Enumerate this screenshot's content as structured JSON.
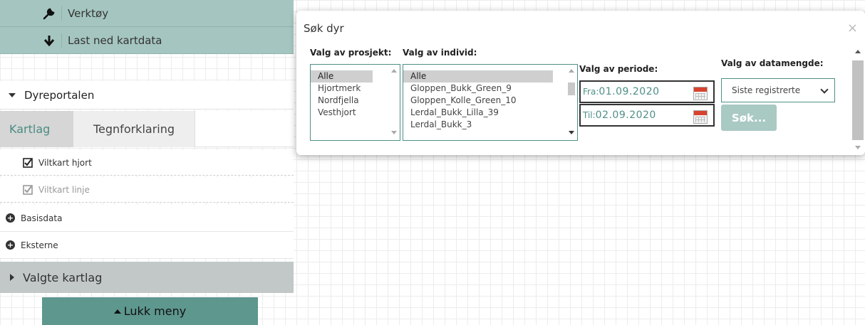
{
  "menu": {
    "tools_label": "Verktøy",
    "download_label": "Last ned kartdata",
    "portal_section": "Dyreportalen",
    "tabs": [
      {
        "label": "Kartlag"
      },
      {
        "label": "Tegnforklaring"
      }
    ],
    "layers": [
      {
        "label": "Viltkart hjort",
        "checked": true
      },
      {
        "label": "Viltkart linje",
        "checked": true
      }
    ],
    "groups": [
      {
        "label": "Basisdata"
      },
      {
        "label": "Eksterne"
      }
    ],
    "selected_layers": "Valgte kartlag",
    "close_menu": "Lukk meny"
  },
  "dialog": {
    "title": "Søk dyr",
    "close": "×",
    "project_label": "Valg av prosjekt:",
    "projects": [
      "Alle",
      "Hjortmerk",
      "Nordfjella",
      "Vesthjort"
    ],
    "individual_label": "Valg av individ:",
    "individuals": [
      "Alle",
      "Gloppen_Bukk_Green_9",
      "Gloppen_Kolle_Green_10",
      "Lerdal_Bukk_Lilla_39",
      "Lerdal_Bukk_3"
    ],
    "period_label": "Valg av periode:",
    "from_prefix": "Fra:",
    "from_value": "01.09.2020",
    "to_prefix": "Til:",
    "to_value": "02.09.2020",
    "amount_label": "Valg av datamengde:",
    "amount_selected": "Siste registrerte",
    "search_button": "Søk..."
  },
  "colors": {
    "menu_teal": "#a5c6c0",
    "accent": "#4e8f86",
    "button_dark": "#5d978e",
    "selected_bar": "#c2c8c7"
  }
}
